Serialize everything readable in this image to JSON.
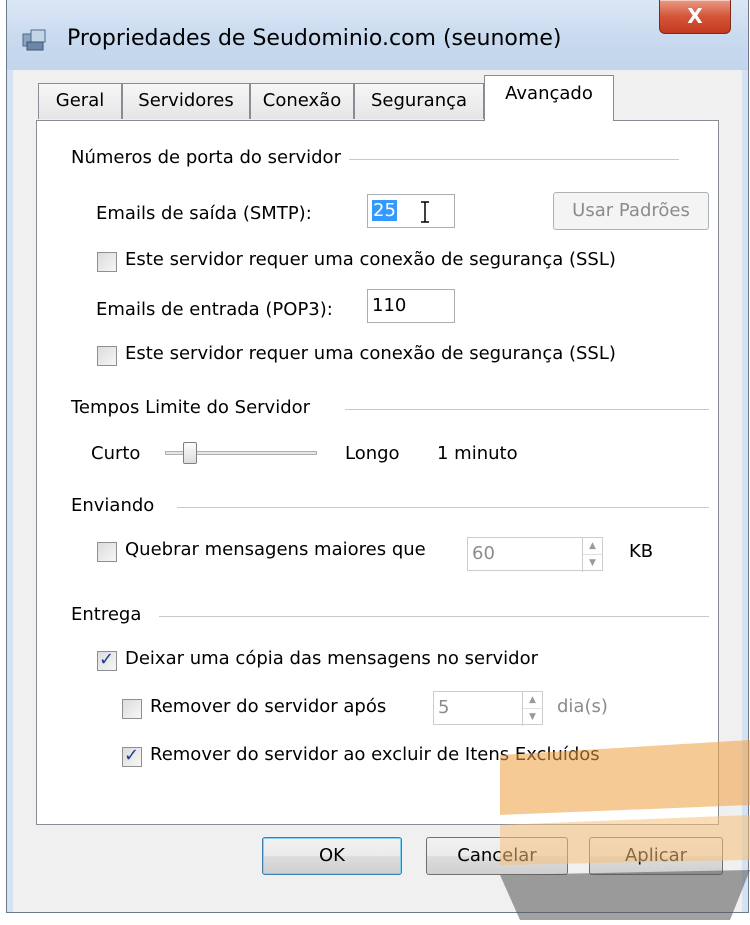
{
  "window": {
    "title": "Propriedades de Seudominio.com (seunome)",
    "close_label": "X"
  },
  "tabs": [
    {
      "label": "Geral",
      "active": false
    },
    {
      "label": "Servidores",
      "active": false
    },
    {
      "label": "Conexão",
      "active": false
    },
    {
      "label": "Segurança",
      "active": false
    },
    {
      "label": "Avançado",
      "active": true
    }
  ],
  "ports": {
    "section_label": "Números de porta do servidor",
    "smtp_label": "Emails de saída (SMTP):",
    "smtp_value": "25",
    "use_defaults_label": "Usar Padrões",
    "smtp_ssl_label": "Este servidor requer uma conexão de segurança (SSL)",
    "smtp_ssl_checked": false,
    "pop3_label": "Emails de entrada (POP3):",
    "pop3_value": "110",
    "pop3_ssl_label": "Este servidor requer uma conexão de segurança (SSL)",
    "pop3_ssl_checked": false
  },
  "timeouts": {
    "section_label": "Tempos Limite do Servidor",
    "short_label": "Curto",
    "long_label": "Longo",
    "value_label": "1 minuto",
    "slider_level": 0.15
  },
  "sending": {
    "section_label": "Enviando",
    "break_label": "Quebrar mensagens maiores que",
    "break_checked": false,
    "size_value": "60",
    "unit_label": "KB"
  },
  "delivery": {
    "section_label": "Entrega",
    "leave_copy_label": "Deixar uma cópia das mensagens no servidor",
    "leave_copy_checked": true,
    "remove_after_label": "Remover do servidor após",
    "remove_after_checked": false,
    "days_value": "5",
    "days_unit": "dia(s)",
    "remove_deleted_label": "Remover do servidor ao excluir de Itens Excluídos",
    "remove_deleted_checked": true
  },
  "buttons": {
    "ok": "OK",
    "cancel": "Cancelar",
    "apply": "Aplicar"
  },
  "colors": {
    "selection": "#3399ff",
    "check_mark": "#1c3f8c",
    "close_red": "#c4391d",
    "frame_blue": "#d4e2f2"
  }
}
